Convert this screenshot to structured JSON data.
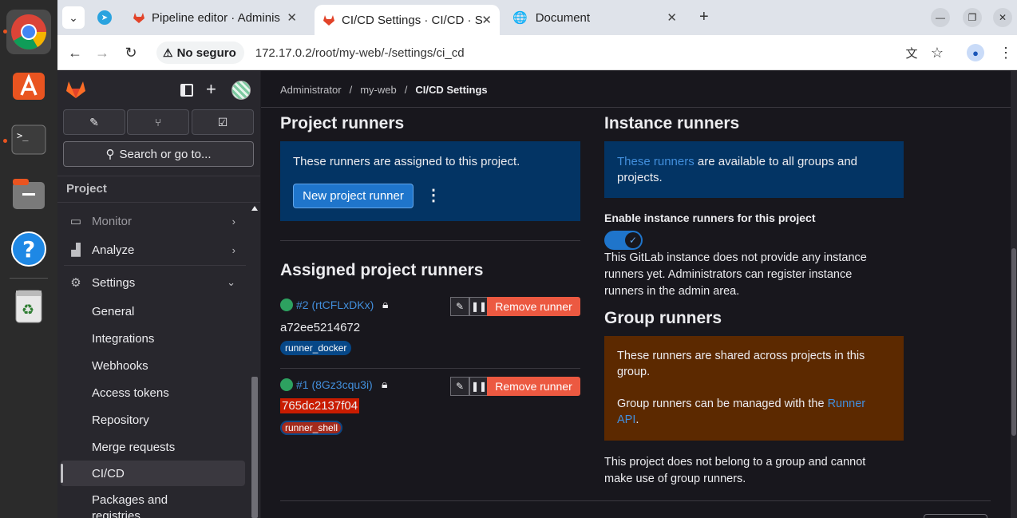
{
  "dock": {
    "items": [
      {
        "name": "chrome-icon"
      },
      {
        "name": "app-center-icon"
      },
      {
        "name": "terminal-icon"
      },
      {
        "name": "files-icon"
      },
      {
        "name": "help-icon"
      },
      {
        "name": "trash-icon"
      }
    ]
  },
  "browser": {
    "tabs": [
      {
        "title": "Pipeline editor · Adminis"
      },
      {
        "title": "CI/CD Settings · CI/CD · S"
      },
      {
        "title": "Document"
      }
    ],
    "security_chip": "No seguro",
    "url": "172.17.0.2/root/my-web/-/settings/ci_cd"
  },
  "sidebar": {
    "search_label": "Search or go to...",
    "section_title": "Project",
    "items": [
      {
        "label": "Monitor"
      },
      {
        "label": "Analyze"
      },
      {
        "label": "Settings"
      },
      {
        "label": "General"
      },
      {
        "label": "Integrations"
      },
      {
        "label": "Webhooks"
      },
      {
        "label": "Access tokens"
      },
      {
        "label": "Repository"
      },
      {
        "label": "Merge requests"
      },
      {
        "label": "CI/CD"
      },
      {
        "label": "Packages and registries"
      }
    ]
  },
  "breadcrumb": {
    "items": [
      "Administrator",
      "/",
      "my-web",
      "/",
      "CI/CD Settings"
    ]
  },
  "project_runners": {
    "title": "Project runners",
    "info": "These runners are assigned to this project.",
    "new_button": "New project runner",
    "assigned_title": "Assigned project runners",
    "runners": [
      {
        "link": "#2 (rtCFLxDKx)",
        "token": "a72ee5214672",
        "tag": "runner_docker",
        "remove": "Remove runner"
      },
      {
        "link": "#1 (8Gz3cqu3i)",
        "token": "765dc2137f04",
        "tag": "runner_shell",
        "remove": "Remove runner"
      }
    ]
  },
  "instance_runners": {
    "title": "Instance runners",
    "info_link": "These runners",
    "info_rest": " are available to all groups and projects.",
    "toggle_label": "Enable instance runners for this project",
    "toggle_on": true,
    "note": "This GitLab instance does not provide any instance runners yet. Administrators can register instance runners in the admin area."
  },
  "group_runners": {
    "title": "Group runners",
    "info1": "These runners are shared across projects in this group.",
    "info2_pre": "Group runners can be managed with the ",
    "info2_link": "Runner API",
    "info2_post": ".",
    "note": "This project does not belong to a group and cannot make use of group runners."
  }
}
